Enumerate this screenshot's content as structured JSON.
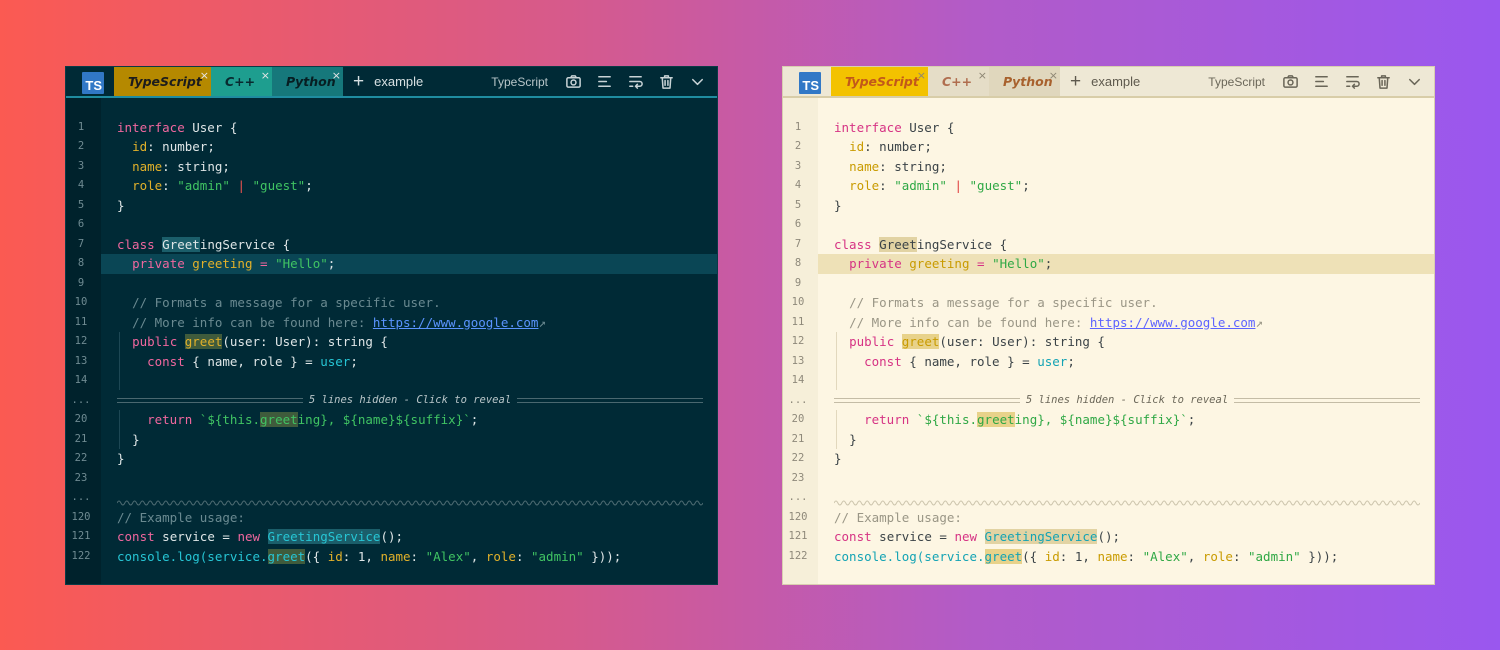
{
  "tabs": [
    {
      "label": "TypeScript",
      "close": "×"
    },
    {
      "label": "C++",
      "close": "×"
    },
    {
      "label": "Python",
      "close": "×"
    }
  ],
  "logo_text": "TS",
  "add_tab_symbol": "+",
  "filename": "example",
  "language": "TypeScript",
  "toolbar_icons": [
    "camera-icon",
    "align-icon",
    "wrap-icon",
    "trash-icon",
    "chevron-down-icon"
  ],
  "fold_text": "5 lines hidden - Click to reveal",
  "gutter_ellipsis": "...",
  "line_numbers": {
    "l1": "1",
    "l2": "2",
    "l3": "3",
    "l4": "4",
    "l5": "5",
    "l6": "6",
    "l7": "7",
    "l8": "8",
    "l9": "9",
    "l10": "10",
    "l11": "11",
    "l12": "12",
    "l13": "13",
    "l14": "14",
    "l20": "20",
    "l21": "21",
    "l22": "22",
    "l23": "23",
    "l120": "120",
    "l121": "121",
    "l122": "122"
  },
  "code": {
    "interface": "interface",
    "user_open": " User {",
    "id": "id",
    "id_rest": ": number;",
    "name": "name",
    "name_rest": ": string;",
    "role": "role",
    "role_colon": ": ",
    "admin": "\"admin\"",
    "pipe": "|",
    "guest": "\"guest\"",
    "semi": ";",
    "close": "}",
    "class": "class",
    "greet_mark": "Greet",
    "greeting_rest": "ingService {",
    "private": "private",
    "greeting": "greeting",
    "eq": " = ",
    "hello": "\"Hello\"",
    "comment1": "// Formats a message for a specific user.",
    "comment2": "// More info can be found here: ",
    "url": "https://www.google.com",
    "extlink": "↗",
    "public": "public",
    "greet_fn": "greet",
    "greet_params": "(user: User): string {",
    "const": "const",
    "destructure": " { name, role } = ",
    "user": "user",
    "return": "return",
    "tpl_a": "`${this.",
    "tpl_greet": "greet",
    "tpl_b": "ing}, ${name}${suffix}`",
    "comment3": "// Example usage:",
    "service": " service = ",
    "new": "new",
    "greeting_service": "GreetingService",
    "gs_rest": "();",
    "console": "console.log(service.",
    "call_open": "({ ",
    "id_val": ": 1, ",
    "name_val": "\"Alex\"",
    "comma": ", ",
    "call_close": " }));"
  },
  "colors": {
    "dark_bg": "#002a36",
    "light_bg": "#fdf6e3",
    "dark_active_tab": "#b58900",
    "light_active_tab": "#f3c200"
  }
}
